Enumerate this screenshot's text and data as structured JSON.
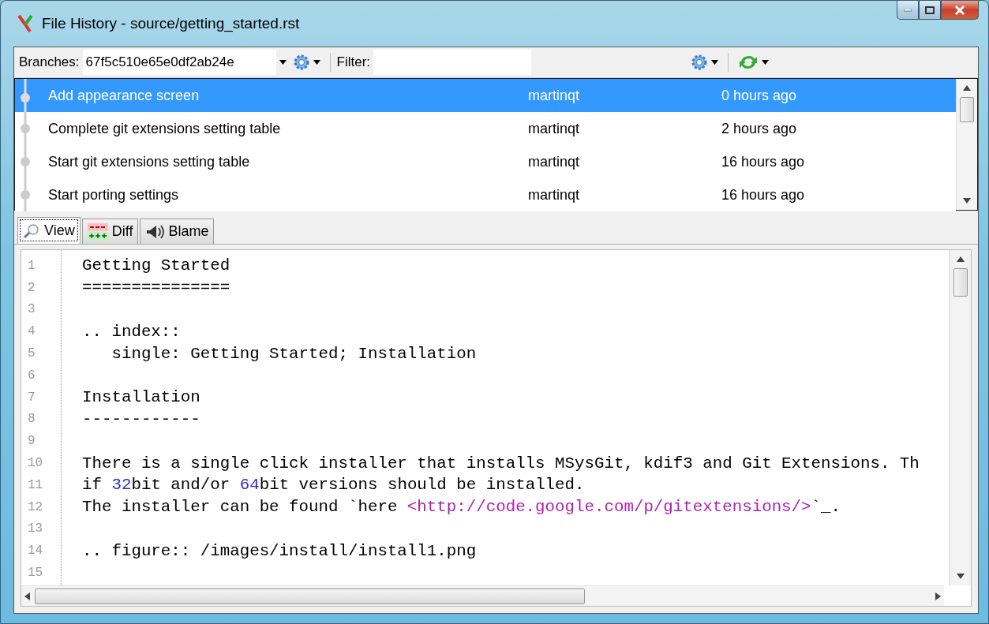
{
  "window": {
    "title": "File History - source/getting_started.rst"
  },
  "toolbar": {
    "branches_label": "Branches:",
    "branch_value": "67f5c510e65e0df2ab24e",
    "filter_label": "Filter:"
  },
  "commits": [
    {
      "message": "Add appearance screen",
      "author": "martinqt",
      "date": "0 hours ago",
      "selected": true
    },
    {
      "message": "Complete git extensions setting table",
      "author": "martinqt",
      "date": "2 hours ago",
      "selected": false
    },
    {
      "message": "Start git extensions setting table",
      "author": "martinqt",
      "date": "16 hours ago",
      "selected": false
    },
    {
      "message": "Start porting settings",
      "author": "martinqt",
      "date": "16 hours ago",
      "selected": false
    }
  ],
  "tabs": [
    {
      "label": "View",
      "kind": "view",
      "selected": true
    },
    {
      "label": "Diff",
      "kind": "diff",
      "selected": false
    },
    {
      "label": "Blame",
      "kind": "blame",
      "selected": false
    }
  ],
  "code": [
    {
      "number": "1",
      "segments": [
        {
          "kind": "plain",
          "text": "Getting Started"
        }
      ]
    },
    {
      "number": "2",
      "segments": [
        {
          "kind": "plain",
          "text": "==============="
        }
      ]
    },
    {
      "number": "3"
    },
    {
      "number": "4",
      "segments": [
        {
          "kind": "plain",
          "text": ".. index::"
        }
      ]
    },
    {
      "number": "5",
      "segments": [
        {
          "kind": "plain",
          "text": "   single: Getting Started; Installation"
        }
      ]
    },
    {
      "number": "6"
    },
    {
      "number": "7",
      "segments": [
        {
          "kind": "plain",
          "text": "Installation"
        }
      ]
    },
    {
      "number": "8",
      "segments": [
        {
          "kind": "plain",
          "text": "------------"
        }
      ]
    },
    {
      "number": "9"
    },
    {
      "number": "10",
      "segments": [
        {
          "kind": "plain",
          "text": "There is a single click installer that installs MSysGit, kdif3 and Git Extensions. Th"
        }
      ]
    },
    {
      "number": "11",
      "segments": [
        {
          "kind": "plain",
          "text": "if "
        },
        {
          "kind": "number",
          "text": "32"
        },
        {
          "kind": "plain",
          "text": "bit and/or "
        },
        {
          "kind": "number",
          "text": "64"
        },
        {
          "kind": "plain",
          "text": "bit versions should be installed."
        }
      ]
    },
    {
      "number": "12",
      "segments": [
        {
          "kind": "plain",
          "text": "The installer can be found `here "
        },
        {
          "kind": "link",
          "text": "<http://code.google.com/p/gitextensions/>"
        },
        {
          "kind": "plain",
          "text": "`_."
        }
      ]
    },
    {
      "number": "13"
    },
    {
      "number": "14",
      "segments": [
        {
          "kind": "plain",
          "text": ".. figure:: /images/install/install1.png"
        }
      ]
    },
    {
      "number": "15"
    }
  ]
}
